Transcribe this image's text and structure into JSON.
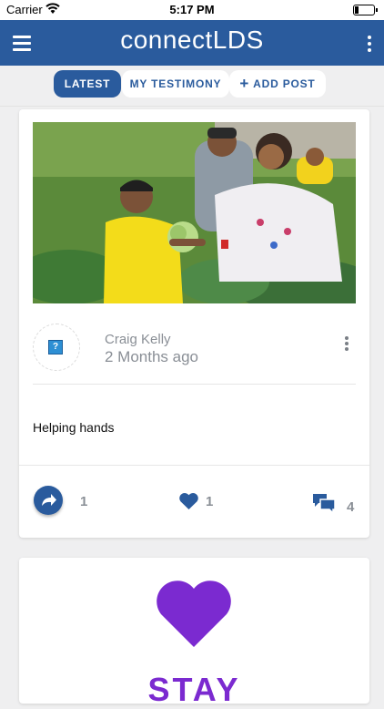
{
  "status_bar": {
    "carrier": "Carrier",
    "time": "5:17 PM",
    "battery_level": 0.2
  },
  "header": {
    "logo_text": "connectLDS",
    "menu_icon": "hamburger-menu-icon",
    "more_icon": "vertical-dots-icon",
    "brand_color": "#2a5b9d"
  },
  "tabs": [
    {
      "label": "LATEST",
      "active": true
    },
    {
      "label": "MY TESTIMONY",
      "active": false
    },
    {
      "label": "ADD POST",
      "active": false,
      "icon": "plus-icon"
    }
  ],
  "posts": [
    {
      "image": "family-garden-cabbage-photo",
      "author": "Craig Kelly",
      "time_ago": "2 Months ago",
      "text": "Helping hands",
      "share_count": "1",
      "like_count": "1",
      "comment_count": "4"
    },
    {
      "icon": "purple-heart-icon",
      "accent_color": "#7b2ad0",
      "text_partial": "STAY"
    }
  ]
}
